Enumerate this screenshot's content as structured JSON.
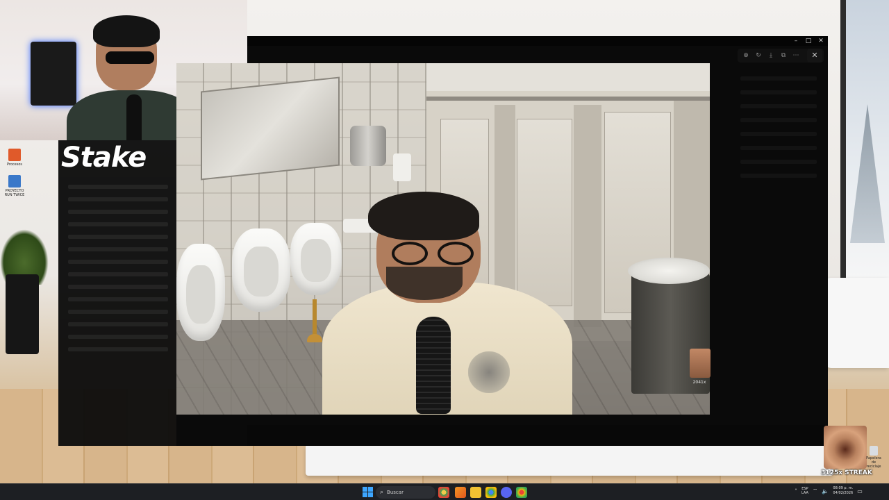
{
  "desktop": {
    "icons": [
      {
        "label": "Procesos",
        "color": "#e05a2a"
      },
      {
        "label": "PROYECTO RUN TWICE",
        "color": "#3a78c9"
      }
    ],
    "recycle_label": "Papelera de reciclaje"
  },
  "overlay": {
    "brand_logo": "Stake",
    "meme_badge": "2041x",
    "streak_label": "3125x STREAK"
  },
  "viewer": {
    "title": "",
    "toolbar_icons": [
      "zoom-in-icon",
      "rotate-icon",
      "download-icon",
      "fullscreen-icon",
      "more-icon"
    ],
    "close_glyph": "✕",
    "window_controls": [
      "–",
      "□",
      "✕"
    ]
  },
  "taskbar": {
    "search_placeholder": "Buscar",
    "apps": [
      "file-explorer",
      "chrome",
      "folder",
      "discord",
      "chrome-alt",
      "vlc"
    ],
    "language_line1": "ESP",
    "language_line2": "LAA",
    "time": "08:09 p. m.",
    "date": "04/02/2026"
  },
  "colors": {
    "taskbar_bg": "#1d1f23",
    "start_blue": "#3da6ff",
    "viewer_bg": "#0a0a0a"
  }
}
